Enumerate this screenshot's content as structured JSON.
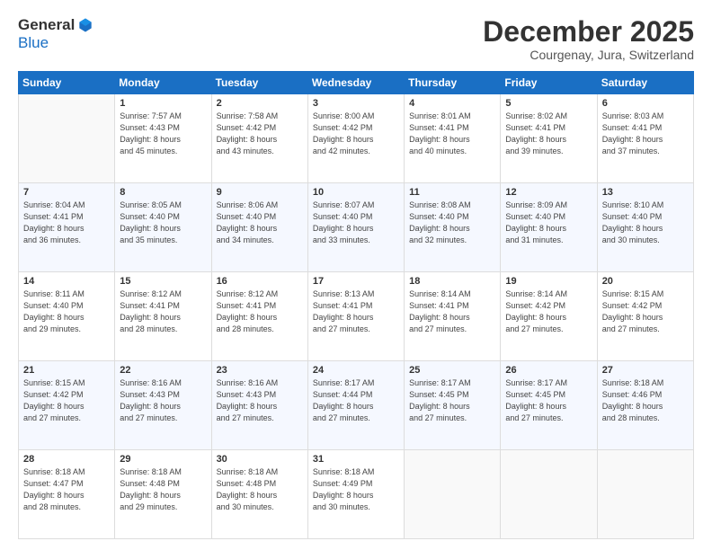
{
  "logo": {
    "general": "General",
    "blue": "Blue"
  },
  "header": {
    "month": "December 2025",
    "location": "Courgenay, Jura, Switzerland"
  },
  "days": [
    "Sunday",
    "Monday",
    "Tuesday",
    "Wednesday",
    "Thursday",
    "Friday",
    "Saturday"
  ],
  "weeks": [
    [
      {
        "day": "",
        "info": ""
      },
      {
        "day": "1",
        "info": "Sunrise: 7:57 AM\nSunset: 4:43 PM\nDaylight: 8 hours\nand 45 minutes."
      },
      {
        "day": "2",
        "info": "Sunrise: 7:58 AM\nSunset: 4:42 PM\nDaylight: 8 hours\nand 43 minutes."
      },
      {
        "day": "3",
        "info": "Sunrise: 8:00 AM\nSunset: 4:42 PM\nDaylight: 8 hours\nand 42 minutes."
      },
      {
        "day": "4",
        "info": "Sunrise: 8:01 AM\nSunset: 4:41 PM\nDaylight: 8 hours\nand 40 minutes."
      },
      {
        "day": "5",
        "info": "Sunrise: 8:02 AM\nSunset: 4:41 PM\nDaylight: 8 hours\nand 39 minutes."
      },
      {
        "day": "6",
        "info": "Sunrise: 8:03 AM\nSunset: 4:41 PM\nDaylight: 8 hours\nand 37 minutes."
      }
    ],
    [
      {
        "day": "7",
        "info": "Sunrise: 8:04 AM\nSunset: 4:41 PM\nDaylight: 8 hours\nand 36 minutes."
      },
      {
        "day": "8",
        "info": "Sunrise: 8:05 AM\nSunset: 4:40 PM\nDaylight: 8 hours\nand 35 minutes."
      },
      {
        "day": "9",
        "info": "Sunrise: 8:06 AM\nSunset: 4:40 PM\nDaylight: 8 hours\nand 34 minutes."
      },
      {
        "day": "10",
        "info": "Sunrise: 8:07 AM\nSunset: 4:40 PM\nDaylight: 8 hours\nand 33 minutes."
      },
      {
        "day": "11",
        "info": "Sunrise: 8:08 AM\nSunset: 4:40 PM\nDaylight: 8 hours\nand 32 minutes."
      },
      {
        "day": "12",
        "info": "Sunrise: 8:09 AM\nSunset: 4:40 PM\nDaylight: 8 hours\nand 31 minutes."
      },
      {
        "day": "13",
        "info": "Sunrise: 8:10 AM\nSunset: 4:40 PM\nDaylight: 8 hours\nand 30 minutes."
      }
    ],
    [
      {
        "day": "14",
        "info": "Sunrise: 8:11 AM\nSunset: 4:40 PM\nDaylight: 8 hours\nand 29 minutes."
      },
      {
        "day": "15",
        "info": "Sunrise: 8:12 AM\nSunset: 4:41 PM\nDaylight: 8 hours\nand 28 minutes."
      },
      {
        "day": "16",
        "info": "Sunrise: 8:12 AM\nSunset: 4:41 PM\nDaylight: 8 hours\nand 28 minutes."
      },
      {
        "day": "17",
        "info": "Sunrise: 8:13 AM\nSunset: 4:41 PM\nDaylight: 8 hours\nand 27 minutes."
      },
      {
        "day": "18",
        "info": "Sunrise: 8:14 AM\nSunset: 4:41 PM\nDaylight: 8 hours\nand 27 minutes."
      },
      {
        "day": "19",
        "info": "Sunrise: 8:14 AM\nSunset: 4:42 PM\nDaylight: 8 hours\nand 27 minutes."
      },
      {
        "day": "20",
        "info": "Sunrise: 8:15 AM\nSunset: 4:42 PM\nDaylight: 8 hours\nand 27 minutes."
      }
    ],
    [
      {
        "day": "21",
        "info": "Sunrise: 8:15 AM\nSunset: 4:42 PM\nDaylight: 8 hours\nand 27 minutes."
      },
      {
        "day": "22",
        "info": "Sunrise: 8:16 AM\nSunset: 4:43 PM\nDaylight: 8 hours\nand 27 minutes."
      },
      {
        "day": "23",
        "info": "Sunrise: 8:16 AM\nSunset: 4:43 PM\nDaylight: 8 hours\nand 27 minutes."
      },
      {
        "day": "24",
        "info": "Sunrise: 8:17 AM\nSunset: 4:44 PM\nDaylight: 8 hours\nand 27 minutes."
      },
      {
        "day": "25",
        "info": "Sunrise: 8:17 AM\nSunset: 4:45 PM\nDaylight: 8 hours\nand 27 minutes."
      },
      {
        "day": "26",
        "info": "Sunrise: 8:17 AM\nSunset: 4:45 PM\nDaylight: 8 hours\nand 27 minutes."
      },
      {
        "day": "27",
        "info": "Sunrise: 8:18 AM\nSunset: 4:46 PM\nDaylight: 8 hours\nand 28 minutes."
      }
    ],
    [
      {
        "day": "28",
        "info": "Sunrise: 8:18 AM\nSunset: 4:47 PM\nDaylight: 8 hours\nand 28 minutes."
      },
      {
        "day": "29",
        "info": "Sunrise: 8:18 AM\nSunset: 4:48 PM\nDaylight: 8 hours\nand 29 minutes."
      },
      {
        "day": "30",
        "info": "Sunrise: 8:18 AM\nSunset: 4:48 PM\nDaylight: 8 hours\nand 30 minutes."
      },
      {
        "day": "31",
        "info": "Sunrise: 8:18 AM\nSunset: 4:49 PM\nDaylight: 8 hours\nand 30 minutes."
      },
      {
        "day": "",
        "info": ""
      },
      {
        "day": "",
        "info": ""
      },
      {
        "day": "",
        "info": ""
      }
    ]
  ]
}
